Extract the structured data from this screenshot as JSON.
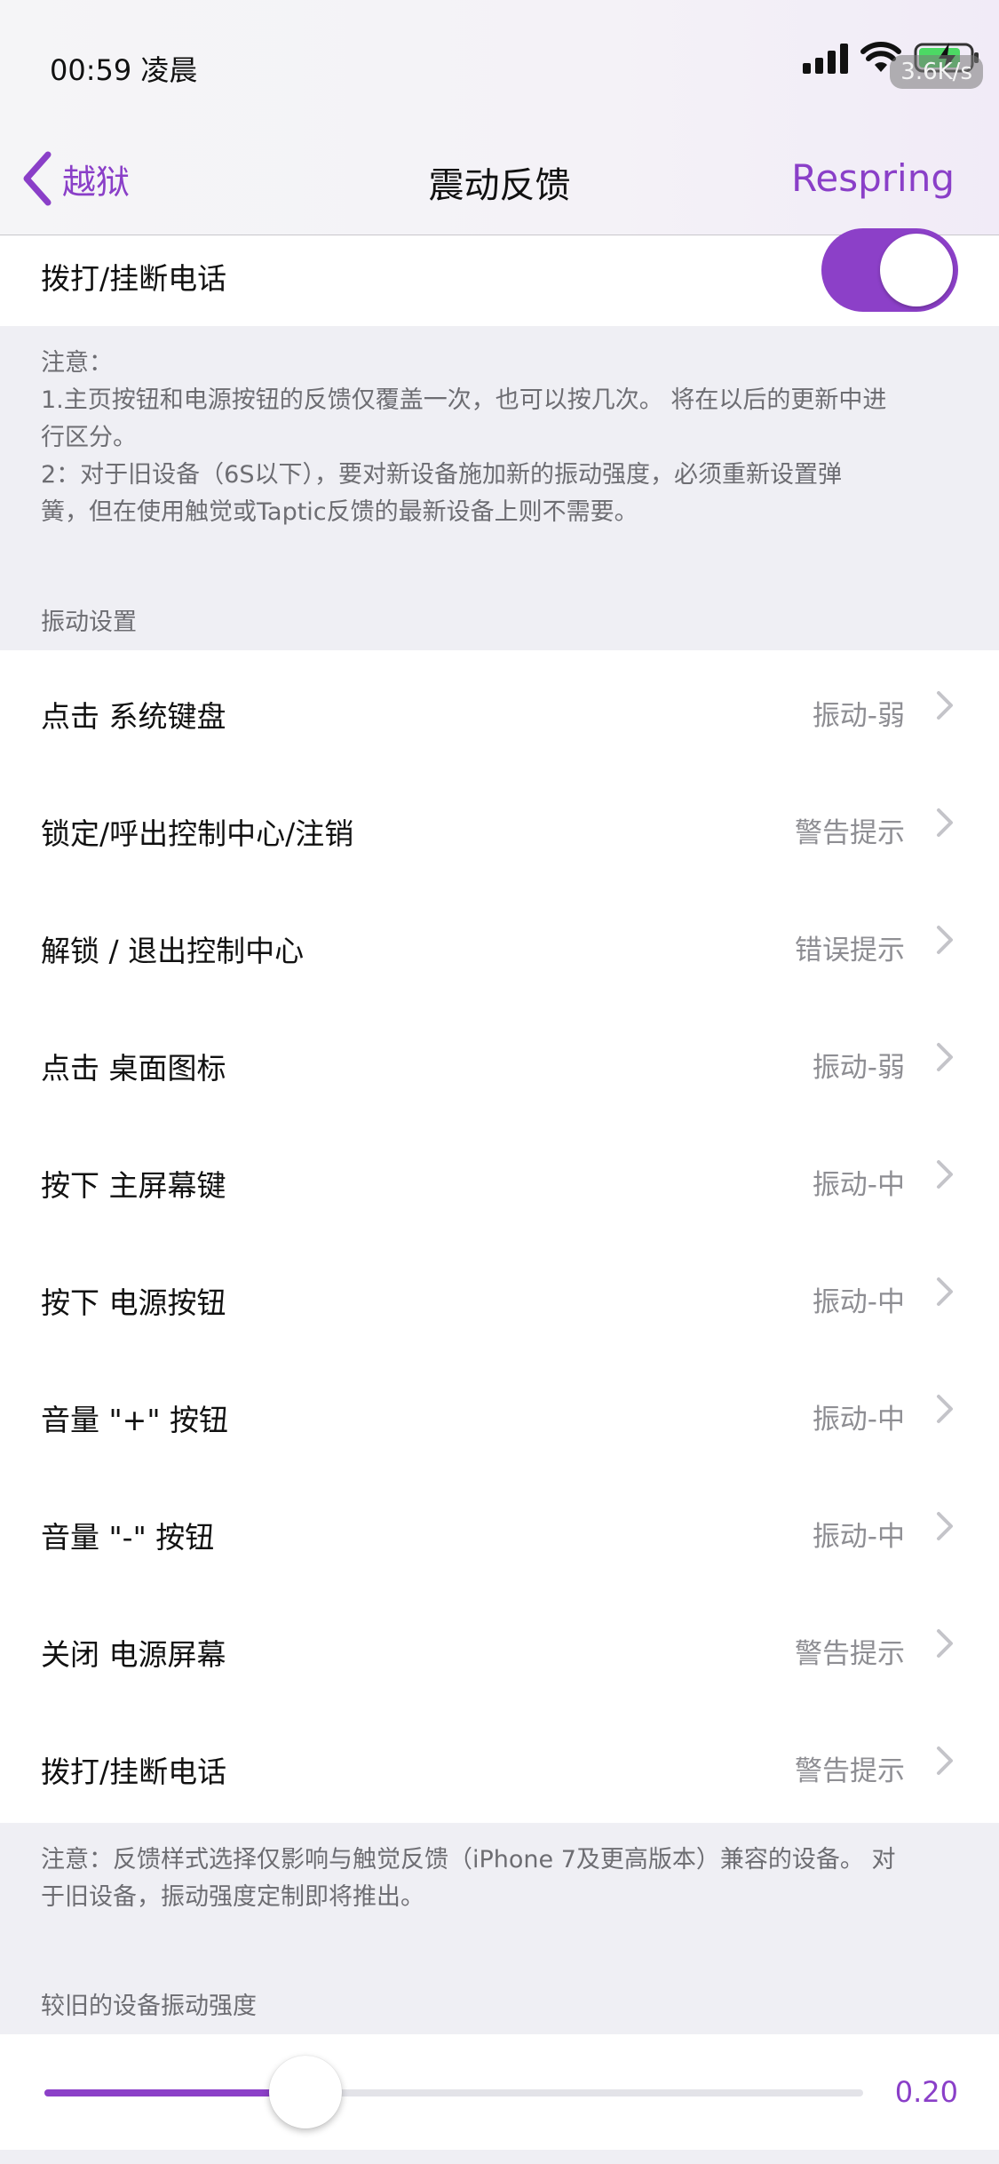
{
  "status_bar": {
    "time": "00:59 凌晨",
    "net_speed": "3.6K/s"
  },
  "nav": {
    "back_label": "越狱",
    "title": "震动反馈",
    "action_label": "Respring",
    "accent_color": "#8a3fc8"
  },
  "top_row": {
    "label": "拨打/挂断电话",
    "toggle_on": true
  },
  "note1": {
    "lines": [
      "注意：",
      "1.主页按钮和电源按钮的反馈仅覆盖一次，也可以按几次。 将在以后的更新中进",
      "行区分。",
      "2：对于旧设备（6S以下），要对新设备施加新的振动强度，必须重新设置弹",
      "簧，但在使用触觉或Taptic反馈的最新设备上则不需要。"
    ]
  },
  "section_vibration": {
    "header": "振动设置",
    "rows": [
      {
        "label": "点击 系统键盘",
        "value": "振动-弱"
      },
      {
        "label": "锁定/呼出控制中心/注销",
        "value": "警告提示"
      },
      {
        "label": "解锁 / 退出控制中心",
        "value": "错误提示"
      },
      {
        "label": "点击 桌面图标",
        "value": "振动-弱"
      },
      {
        "label": "按下 主屏幕键",
        "value": "振动-中"
      },
      {
        "label": "按下 电源按钮",
        "value": "振动-中"
      },
      {
        "label": "音量 \"+\" 按钮",
        "value": "振动-中"
      },
      {
        "label": "音量 \"-\" 按钮",
        "value": "振动-中"
      },
      {
        "label": "关闭 电源屏幕",
        "value": "警告提示"
      },
      {
        "label": "拨打/挂断电话",
        "value": "警告提示"
      }
    ]
  },
  "note2": {
    "lines": [
      "注意：反馈样式选择仅影响与触觉反馈（iPhone 7及更高版本）兼容的设备。 对",
      "于旧设备，振动强度定制即将推出。"
    ]
  },
  "section_old_device": {
    "header": "较旧的设备振动强度",
    "slider_value": 0.2,
    "slider_value_label": "0.20"
  }
}
